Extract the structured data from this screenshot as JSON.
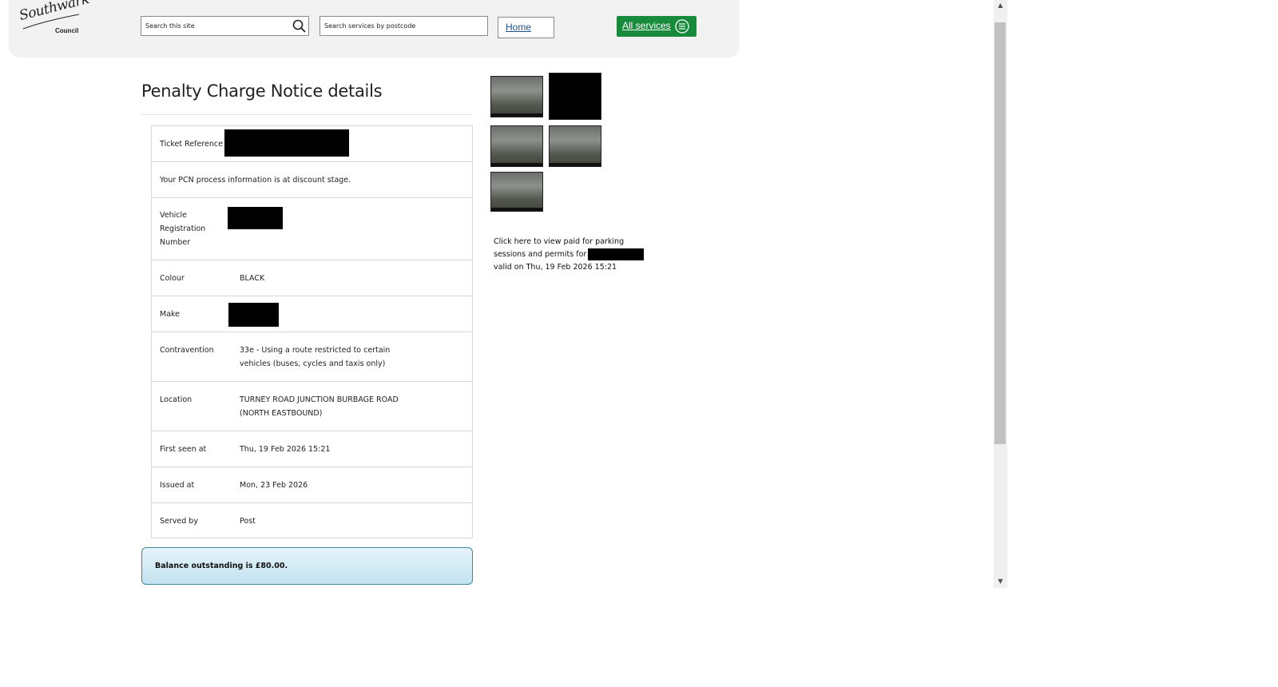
{
  "header": {
    "logo_word": "Southwark",
    "logo_sub": "Council",
    "search_site_placeholder": "Search this site",
    "search_postcode_placeholder": "Search services by postcode",
    "home_label": "Home",
    "all_services_label": "All services"
  },
  "main": {
    "title": "Penalty Charge Notice details",
    "rows": {
      "ticket_reference": {
        "label": "Ticket Reference"
      },
      "process_info": {
        "text": "Your PCN process information is at discount stage."
      },
      "vrn": {
        "label_line1": "Vehicle",
        "label_line2": "Registration",
        "label_line3": "Number"
      },
      "colour": {
        "label": "Colour",
        "value": "BLACK"
      },
      "make": {
        "label": "Make"
      },
      "contravention": {
        "label": "Contravention",
        "value_line1": "33e - Using a route restricted to certain",
        "value_line2": "vehicles (buses, cycles and taxis only)"
      },
      "location": {
        "label": "Location",
        "value_line1": "TURNEY ROAD JUNCTION BURBAGE ROAD",
        "value_line2": "(NORTH EASTBOUND)"
      },
      "first_seen": {
        "label": "First seen at",
        "value": "Thu, 19 Feb 2026 15:21"
      },
      "issued": {
        "label": "Issued at",
        "value": "Mon, 23 Feb 2026"
      },
      "served": {
        "label": "Served by",
        "value": "Post"
      }
    },
    "balance": "Balance outstanding is £80.00."
  },
  "side": {
    "parking_line1": "Click here to view paid for parking",
    "parking_line2": "sessions and permits for",
    "parking_line3": "valid on Thu, 19 Feb 2026 15:21"
  },
  "colors": {
    "accent_green": "#178a3c",
    "link_blue": "#1d4f8f",
    "balance_border": "#3f8aa3"
  }
}
